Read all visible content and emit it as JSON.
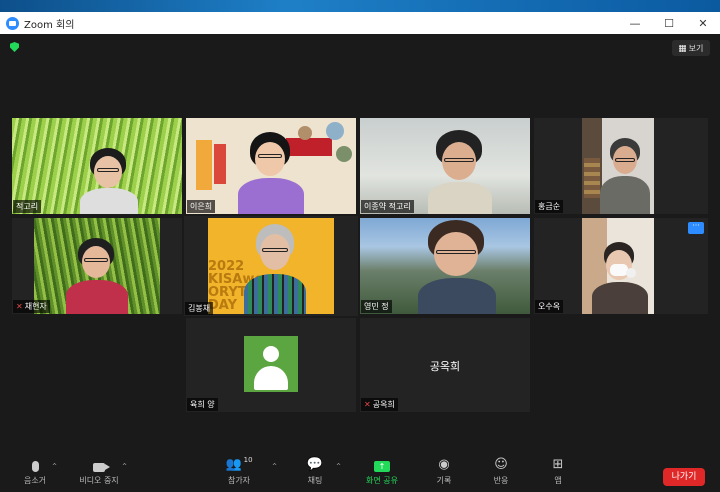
{
  "window": {
    "title": "Zoom 회의"
  },
  "window_controls": {
    "minimize": "—",
    "maximize": "☐",
    "close": "✕"
  },
  "view_button": {
    "label": "보기"
  },
  "participants": [
    {
      "name": "적고리",
      "muted": false
    },
    {
      "name": "이은희",
      "muted": false
    },
    {
      "name": "이종약 적고리",
      "muted": false
    },
    {
      "name": "홍금순",
      "muted": false
    },
    {
      "name": "채현자",
      "muted": true
    },
    {
      "name": "김봉채",
      "muted": false,
      "speaking": true
    },
    {
      "name": "영민 정",
      "muted": false
    },
    {
      "name": "오수옥",
      "muted": false
    },
    {
      "name": "육희 양",
      "muted": false,
      "video": false
    },
    {
      "name": "공옥희",
      "muted": true,
      "video": false,
      "center_name": "공옥희"
    }
  ],
  "poster_text": {
    "line1": "2022",
    "line2": "KISAwo",
    "line3": "ORYTELL",
    "line4": "DAY"
  },
  "toolbar": {
    "audio": "음소거",
    "video": "비디오 중지",
    "participants": "참가자",
    "participants_count": "10",
    "chat": "채팅",
    "share": "화면 공유",
    "record": "기록",
    "reactions": "반응",
    "apps": "앱",
    "leave": "나가기"
  },
  "colors": {
    "accent": "#2d8cff",
    "share": "#23d959",
    "leave": "#e02828",
    "speaker": "#e9d84a"
  }
}
